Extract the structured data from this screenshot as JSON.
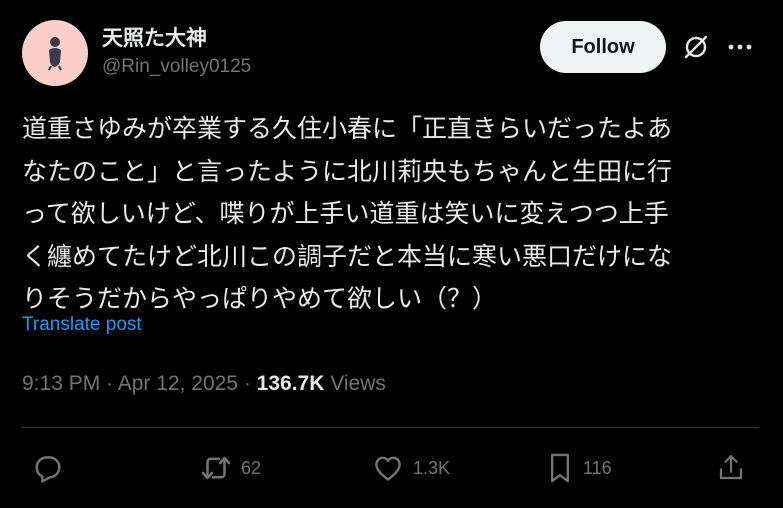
{
  "author": {
    "display_name": "天照た大神",
    "handle": "@Rin_volley0125",
    "avatar_icon": "avatar-silhouette-icon"
  },
  "header": {
    "follow_label": "Follow",
    "grok_icon": "grok-icon",
    "more_icon": "more-icon"
  },
  "tweet": {
    "lines": [
      "道重さゆみが卒業する久住小春に「正直きらいだったよあ",
      "なたのこと」と言ったように北川莉央もちゃんと生田に行",
      "って欲しいけど、喋りが上手い道重は笑いに変えつつ上手",
      "く纏めてたけど北川この調子だと本当に寒い悪口だけにな",
      "りそうだからやっぱりやめて欲しい（？）"
    ],
    "translate_label": "Translate post"
  },
  "meta": {
    "time": "9:13 PM",
    "separator": " · ",
    "date": "Apr 12, 2025",
    "views_count": "136.7K",
    "views_label": "Views"
  },
  "actions": {
    "reply": {
      "icon": "reply-icon",
      "count": ""
    },
    "repost": {
      "icon": "repost-icon",
      "count": "62"
    },
    "like": {
      "icon": "heart-icon",
      "count": "1.3K"
    },
    "bookmark": {
      "icon": "bookmark-icon",
      "count": "116"
    },
    "share": {
      "icon": "share-icon",
      "count": ""
    }
  },
  "colors": {
    "background": "#000000",
    "primary_text": "#e7e9ea",
    "secondary_text": "#71767b",
    "link": "#1d9bf0",
    "follow_button_bg": "#eff3f4",
    "avatar_bg": "#f9cfc8",
    "divider": "#2f3336"
  }
}
